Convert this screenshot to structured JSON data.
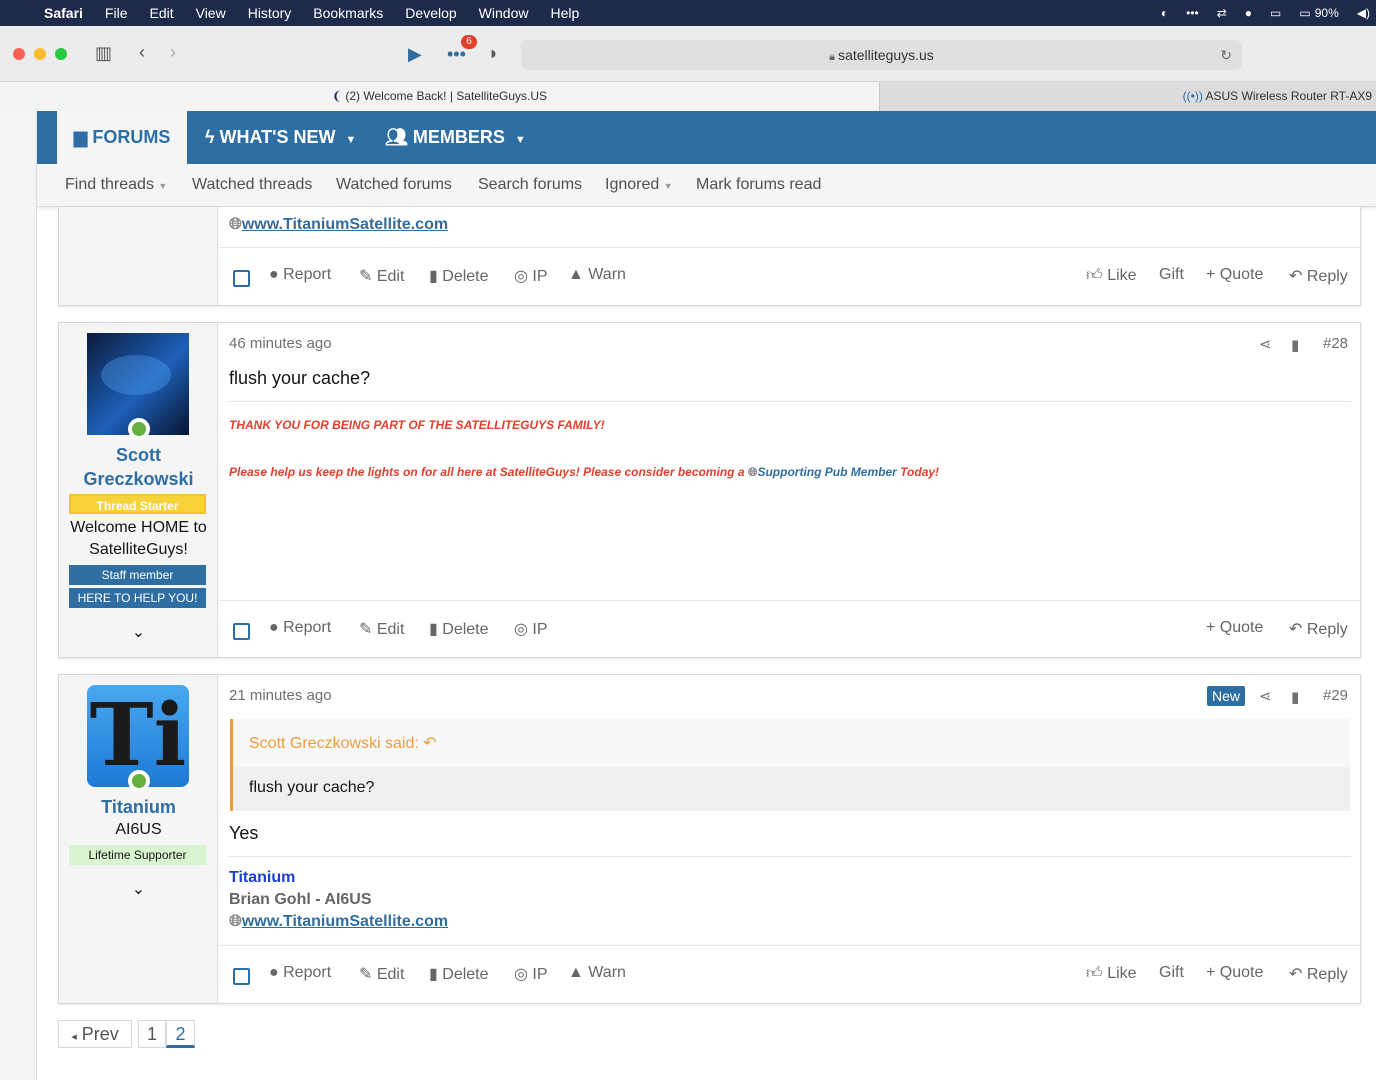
{
  "menubar": {
    "app": "Safari",
    "items": [
      "File",
      "Edit",
      "View",
      "History",
      "Bookmarks",
      "Develop",
      "Window",
      "Help"
    ],
    "battery": "90%",
    "badge_count": "6"
  },
  "browser": {
    "url": "satelliteguys.us",
    "active_tab": "(2) Welcome Back! | SatelliteGuys.US",
    "inactive_tab": "ASUS Wireless Router RT-AX9"
  },
  "nav": {
    "forums": "FORUMS",
    "whats_new": "WHAT'S NEW",
    "members": "MEMBERS"
  },
  "subnav": [
    "Find threads",
    "Watched threads",
    "Watched forums",
    "Search forums",
    "Ignored",
    "Mark forums read"
  ],
  "post_top": {
    "sig_link": "www.TitaniumSatellite.com"
  },
  "actions": {
    "report": "Report",
    "edit": "Edit",
    "delete": "Delete",
    "ip": "IP",
    "warn": "Warn",
    "like": "Like",
    "gift": "Gift",
    "quote": "Quote",
    "reply": "Reply"
  },
  "post28": {
    "time": "46 minutes ago",
    "num": "#28",
    "user_first": "Scott",
    "user_last": "Greczkowski",
    "starter": "Thread Starter",
    "title1": "Welcome HOME to",
    "title2": "SatelliteGuys!",
    "staff": "Staff member",
    "help": "HERE TO HELP YOU!",
    "message": "flush your cache?",
    "red1": "THANK YOU FOR BEING PART OF THE SATELLITEGUYS FAMILY!",
    "red2": "Please help us keep the lights on for all here at SatelliteGuys! Please consider becoming a",
    "red_link": "Supporting Pub Member",
    "red_end": "Today!"
  },
  "post29": {
    "time": "21 minutes ago",
    "new": "New",
    "num": "#29",
    "user": "Titanium",
    "title": "AI6US",
    "supporter": "Lifetime Supporter",
    "quote_author": "Scott Greczkowski said:",
    "quote_text": "flush your cache?",
    "message": "Yes",
    "sig_name": "Titanium",
    "sig_line": "Brian Gohl - AI6US",
    "sig_link": "www.TitaniumSatellite.com"
  },
  "pagination": {
    "prev": "Prev",
    "pages": [
      "1",
      "2"
    ]
  },
  "colors": {
    "nav_blue": "#2f6ea3",
    "red_text": "#e2402c",
    "quote_orange": "#f19c3c",
    "online_green": "#63b03e"
  }
}
